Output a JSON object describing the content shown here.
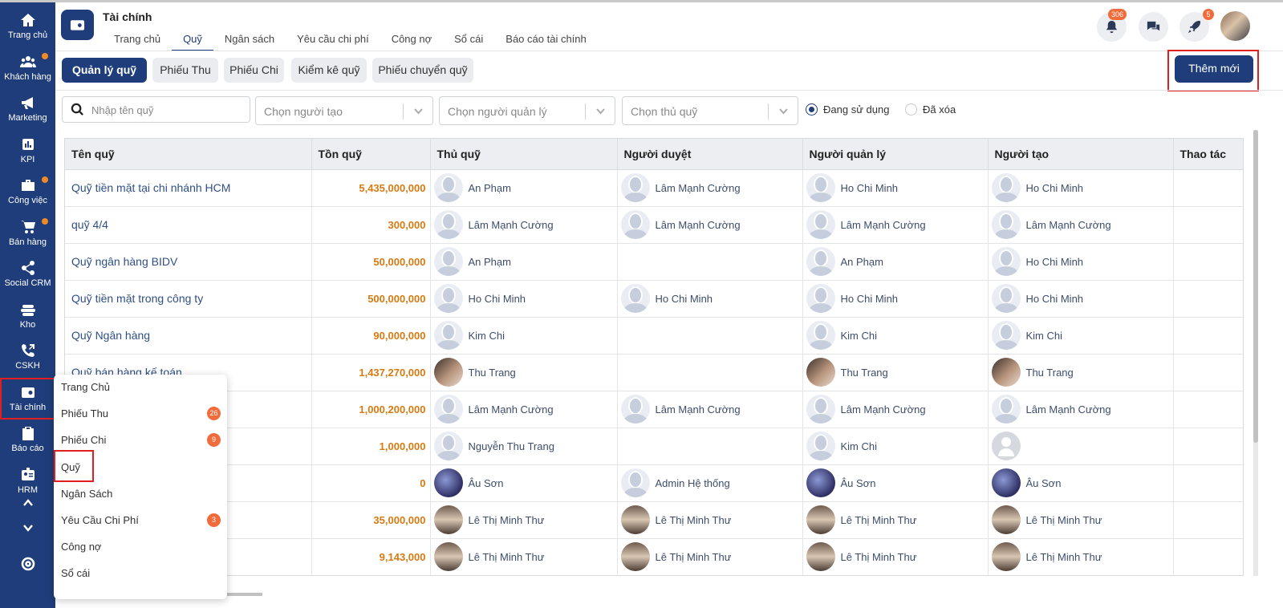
{
  "sidebar": {
    "items": [
      {
        "label": "Trang chủ",
        "icon": "home-icon",
        "dot": false
      },
      {
        "label": "Khách hàng",
        "icon": "users-icon",
        "dot": true
      },
      {
        "label": "Marketing",
        "icon": "megaphone-icon",
        "dot": false
      },
      {
        "label": "KPI",
        "icon": "bar-chart-icon",
        "dot": false
      },
      {
        "label": "Công việc",
        "icon": "briefcase-icon",
        "dot": true
      },
      {
        "label": "Bán hàng",
        "icon": "cart-icon",
        "dot": true
      },
      {
        "label": "Social CRM",
        "icon": "share-icon",
        "dot": false
      },
      {
        "label": "Kho",
        "icon": "stack-icon",
        "dot": false
      },
      {
        "label": "CSKH",
        "icon": "phone-icon",
        "dot": false
      },
      {
        "label": "Tài chính",
        "icon": "wallet-icon",
        "dot": false,
        "active": true
      },
      {
        "label": "Báo cáo",
        "icon": "clipboard-icon",
        "dot": false
      },
      {
        "label": "HRM",
        "icon": "id-card-icon",
        "dot": false
      }
    ]
  },
  "header": {
    "title": "Tài chính",
    "tabs": [
      "Trang chủ",
      "Quỹ",
      "Ngân sách",
      "Yêu cầu chi phí",
      "Công nợ",
      "Sổ cái",
      "Báo cáo tài chính"
    ],
    "active_tab": "Quỹ",
    "notifications_count": "306",
    "rocket_count": "5"
  },
  "subtabs": [
    "Quản lý quỹ",
    "Phiếu Thu",
    "Phiếu Chi",
    "Kiểm kê quỹ",
    "Phiếu chuyển quỹ"
  ],
  "add_button": "Thêm mới",
  "filters": {
    "search_placeholder": "Nhập tên quỹ",
    "creator": "Chọn người tạo",
    "manager": "Chọn người quản lý",
    "treasurer": "Chọn thủ quỹ",
    "radio_active": "Đang sử dụng",
    "radio_deleted": "Đã xóa"
  },
  "table": {
    "columns": [
      "Tên quỹ",
      "Tồn quỹ",
      "Thủ quỹ",
      "Người duyệt",
      "Người quản lý",
      "Người tạo",
      "Thao tác"
    ],
    "rows": [
      {
        "name": "Quỹ tiền mặt tại chi nhánh HCM",
        "amount": "5,435,000,000",
        "treasurer": {
          "name": "An Phạm",
          "av": "blank"
        },
        "approver": {
          "name": "Lâm Mạnh Cường",
          "av": "blank"
        },
        "manager": {
          "name": "Ho Chi Minh",
          "av": "blank"
        },
        "creator": {
          "name": "Ho Chi Minh",
          "av": "blank"
        }
      },
      {
        "name": "quỹ 4/4",
        "amount": "300,000",
        "treasurer": {
          "name": "Lâm Mạnh Cường",
          "av": "blank"
        },
        "approver": {
          "name": "Lâm Mạnh Cường",
          "av": "blank"
        },
        "manager": {
          "name": "Lâm Mạnh Cường",
          "av": "blank"
        },
        "creator": {
          "name": "Lâm Mạnh Cường",
          "av": "blank"
        }
      },
      {
        "name": "Quỹ ngân hàng BIDV",
        "amount": "50,000,000",
        "treasurer": {
          "name": "An Phạm",
          "av": "blank"
        },
        "approver": null,
        "manager": {
          "name": "An Phạm",
          "av": "blank"
        },
        "creator": {
          "name": "Ho Chi Minh",
          "av": "blank"
        }
      },
      {
        "name": "Quỹ tiền mặt trong công ty",
        "amount": "500,000,000",
        "treasurer": {
          "name": "Ho Chi Minh",
          "av": "blank"
        },
        "approver": {
          "name": "Ho Chi Minh",
          "av": "blank"
        },
        "manager": {
          "name": "Ho Chi Minh",
          "av": "blank"
        },
        "creator": {
          "name": "Ho Chi Minh",
          "av": "blank"
        }
      },
      {
        "name": "Quỹ Ngân hàng",
        "amount": "90,000,000",
        "treasurer": {
          "name": "Kim Chi",
          "av": "blank"
        },
        "approver": null,
        "manager": {
          "name": "Kim Chi",
          "av": "blank"
        },
        "creator": {
          "name": "Kim Chi",
          "av": "blank"
        }
      },
      {
        "name": "Quỹ bán hàng kế toán",
        "amount": "1,437,270,000",
        "treasurer": {
          "name": "Thu Trang",
          "av": "photo-f"
        },
        "approver": null,
        "manager": {
          "name": "Thu Trang",
          "av": "photo-f"
        },
        "creator": {
          "name": "Thu Trang",
          "av": "photo-f"
        }
      },
      {
        "name": "",
        "amount": "1,000,200,000",
        "treasurer": {
          "name": "Lâm Mạnh Cường",
          "av": "blank"
        },
        "approver": {
          "name": "Lâm Mạnh Cường",
          "av": "blank"
        },
        "manager": {
          "name": "Lâm Mạnh Cường",
          "av": "blank"
        },
        "creator": {
          "name": "Lâm Mạnh Cường",
          "av": "blank"
        }
      },
      {
        "name": "",
        "amount": "1,000,000",
        "treasurer": {
          "name": "Nguyễn Thu Trang",
          "av": "blank"
        },
        "approver": null,
        "manager": {
          "name": "Kim Chi",
          "av": "blank"
        },
        "creator": {
          "name": "",
          "av": "grey"
        }
      },
      {
        "name": "",
        "amount": "0",
        "treasurer": {
          "name": "Âu Sơn",
          "av": "photo-blue"
        },
        "approver": {
          "name": "Admin Hệ thống",
          "av": "blank"
        },
        "manager": {
          "name": "Âu Sơn",
          "av": "photo-blue"
        },
        "creator": {
          "name": "Âu Sơn",
          "av": "photo-blue"
        }
      },
      {
        "name": "",
        "amount": "35,000,000",
        "treasurer": {
          "name": "Lê Thị Minh Thư",
          "av": "photo-desk"
        },
        "approver": {
          "name": "Lê Thị Minh Thư",
          "av": "photo-desk"
        },
        "manager": {
          "name": "Lê Thị Minh Thư",
          "av": "photo-desk"
        },
        "creator": {
          "name": "Lê Thị Minh Thư",
          "av": "photo-desk"
        }
      },
      {
        "name": "",
        "amount": "9,143,000",
        "treasurer": {
          "name": "Lê Thị Minh Thư",
          "av": "photo-desk"
        },
        "approver": {
          "name": "Lê Thị Minh Thư",
          "av": "photo-desk"
        },
        "manager": {
          "name": "Lê Thị Minh Thư",
          "av": "photo-desk"
        },
        "creator": {
          "name": "Lê Thị Minh Thư",
          "av": "photo-desk"
        }
      }
    ]
  },
  "popup_menu": {
    "items": [
      {
        "label": "Trang Chủ",
        "badge": ""
      },
      {
        "label": "Phiếu Thu",
        "badge": "26"
      },
      {
        "label": "Phiếu Chi",
        "badge": "9"
      },
      {
        "label": "Quỹ",
        "badge": ""
      },
      {
        "label": "Ngân Sách",
        "badge": ""
      },
      {
        "label": "Yêu Cầu Chi Phí",
        "badge": "3"
      },
      {
        "label": "Công nợ",
        "badge": ""
      },
      {
        "label": "Sổ cái",
        "badge": ""
      }
    ]
  },
  "colors": {
    "primary": "#1f3d7a",
    "accent_orange": "#d67a12",
    "badge": "#f26b3a",
    "highlight": "#e02020"
  }
}
